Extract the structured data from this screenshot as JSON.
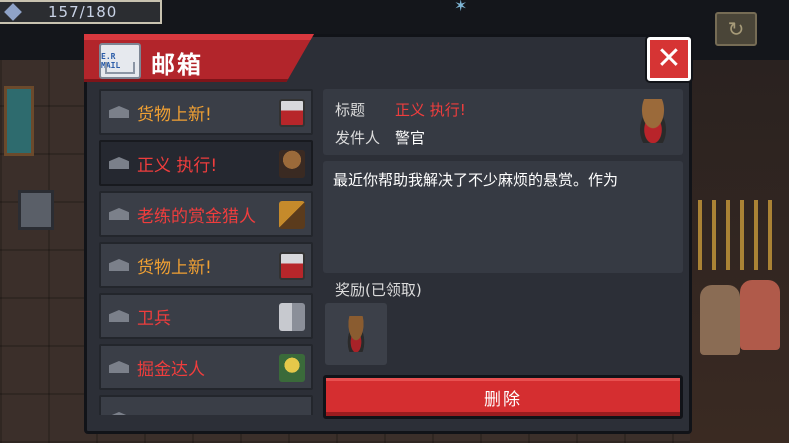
{
  "hud": {
    "energy": "157/180"
  },
  "window": {
    "title": "邮箱",
    "logo_text": "E.R MAIL",
    "close_icon": "close-icon"
  },
  "mail_list": [
    {
      "label": "货物上新!",
      "color": "orange",
      "icon": "knight-icon"
    },
    {
      "label": "正义 执行!",
      "color": "red",
      "icon": "sheriff-icon",
      "selected": true
    },
    {
      "label": "老练的赏金猎人",
      "color": "red",
      "icon": "bounty-hunter-icon"
    },
    {
      "label": "货物上新!",
      "color": "orange",
      "icon": "knight-icon"
    },
    {
      "label": "卫兵",
      "color": "red",
      "icon": "guard-icon"
    },
    {
      "label": "掘金达人",
      "color": "red",
      "icon": "miner-icon"
    }
  ],
  "detail": {
    "title_label": "标题",
    "title_value": "正义 执行!",
    "sender_label": "发件人",
    "sender_value": "警官",
    "body": "最近你帮助我解决了不少麻烦的悬赏。作为",
    "reward_label": "奖励(已领取)",
    "delete_label": "删除"
  },
  "colors": {
    "accent_red": "#d52e30",
    "banner_red": "#b2252b",
    "orange_text": "#f0a033",
    "red_text": "#ef3d3d"
  }
}
